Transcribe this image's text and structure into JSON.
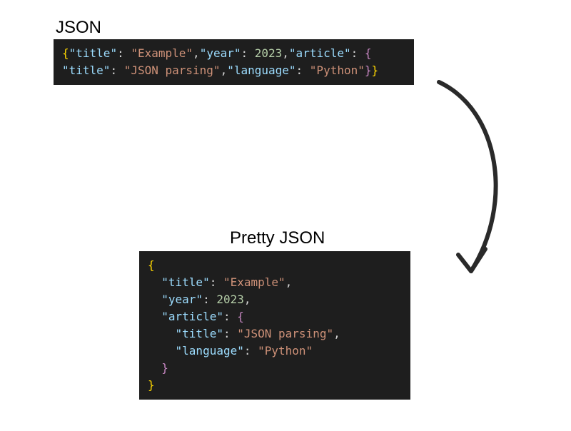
{
  "labels": {
    "json": "JSON",
    "pretty": "Pretty JSON"
  },
  "compact": {
    "line1_parts": {
      "open_brace": "{",
      "key1": "\"title\"",
      "colon": ": ",
      "val1": "\"Example\"",
      "comma": ",",
      "key2": "\"year\"",
      "val2": "2023",
      "key3": "\"article\"",
      "open_brace2": "{"
    },
    "line2_parts": {
      "key4": "\"title\"",
      "val4": "\"JSON parsing\"",
      "key5": "\"language\"",
      "val5": "\"Python\"",
      "close": "}}"
    }
  },
  "pretty": {
    "open": "{",
    "k_title": "\"title\"",
    "v_title": "\"Example\"",
    "k_year": "\"year\"",
    "v_year": "2023",
    "k_article": "\"article\"",
    "k_title2": "\"title\"",
    "v_title2": "\"JSON parsing\"",
    "k_lang": "\"language\"",
    "v_lang": "\"Python\"",
    "close_inner": "}",
    "close": "}",
    "comma": ","
  },
  "colors": {
    "bg_code": "#1e1e1e",
    "brace": "#c586c0",
    "yellow_brace": "#ffd700",
    "key": "#9cdcfe",
    "string": "#ce9178",
    "number": "#b5cea8"
  }
}
